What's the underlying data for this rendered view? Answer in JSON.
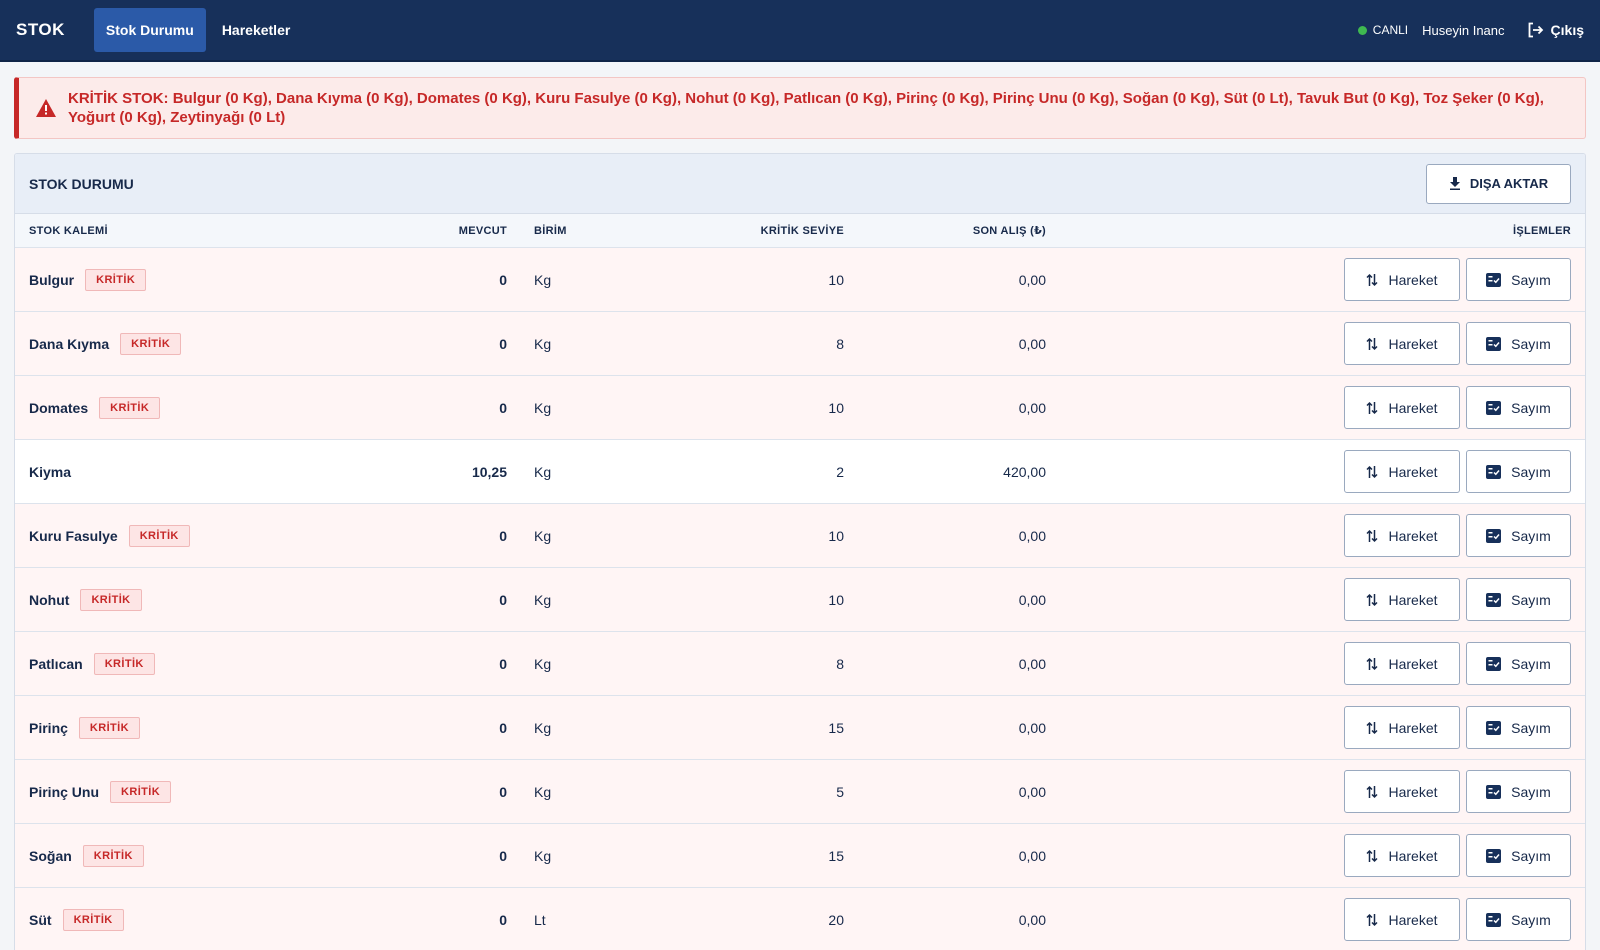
{
  "topbar": {
    "brand": "STOK",
    "tabs": [
      {
        "label": "Stok Durumu",
        "active": true
      },
      {
        "label": "Hareketler",
        "active": false
      }
    ],
    "status": "CANLI",
    "status_color": "#3fb950",
    "user": "Huseyin Inanc",
    "logout_label": "Çıkış"
  },
  "alert": {
    "text": "KRİTİK STOK: Bulgur (0 Kg), Dana Kıyma (0 Kg), Domates (0 Kg), Kuru Fasulye (0 Kg), Nohut (0 Kg), Patlıcan (0 Kg), Pirinç (0 Kg), Pirinç Unu (0 Kg), Soğan (0 Kg), Süt (0 Lt), Tavuk But (0 Kg), Toz Şeker (0 Kg), Yoğurt (0 Kg), Zeytinyağı (0 Lt)",
    "icon": "warning-icon",
    "color": "#c62828"
  },
  "panel": {
    "title": "STOK DURUMU",
    "export_label": "DIŞA AKTAR",
    "columns": {
      "name": "STOK KALEMİ",
      "qty": "MEVCUT",
      "unit": "BİRİM",
      "critical": "KRİTİK SEVİYE",
      "last_price": "SON ALIŞ (₺)",
      "actions": "İŞLEMLER"
    },
    "badge_label": "KRİTİK",
    "move_label": "Hareket",
    "count_label": "Sayım",
    "rows": [
      {
        "name": "Bulgur",
        "critical_flag": true,
        "qty": "0",
        "unit": "Kg",
        "critical_level": "10",
        "last_price": "0,00"
      },
      {
        "name": "Dana Kıyma",
        "critical_flag": true,
        "qty": "0",
        "unit": "Kg",
        "critical_level": "8",
        "last_price": "0,00"
      },
      {
        "name": "Domates",
        "critical_flag": true,
        "qty": "0",
        "unit": "Kg",
        "critical_level": "10",
        "last_price": "0,00"
      },
      {
        "name": "Kiyma",
        "critical_flag": false,
        "qty": "10,25",
        "unit": "Kg",
        "critical_level": "2",
        "last_price": "420,00"
      },
      {
        "name": "Kuru Fasulye",
        "critical_flag": true,
        "qty": "0",
        "unit": "Kg",
        "critical_level": "10",
        "last_price": "0,00"
      },
      {
        "name": "Nohut",
        "critical_flag": true,
        "qty": "0",
        "unit": "Kg",
        "critical_level": "10",
        "last_price": "0,00"
      },
      {
        "name": "Patlıcan",
        "critical_flag": true,
        "qty": "0",
        "unit": "Kg",
        "critical_level": "8",
        "last_price": "0,00"
      },
      {
        "name": "Pirinç",
        "critical_flag": true,
        "qty": "0",
        "unit": "Kg",
        "critical_level": "15",
        "last_price": "0,00"
      },
      {
        "name": "Pirinç Unu",
        "critical_flag": true,
        "qty": "0",
        "unit": "Kg",
        "critical_level": "5",
        "last_price": "0,00"
      },
      {
        "name": "Soğan",
        "critical_flag": true,
        "qty": "0",
        "unit": "Kg",
        "critical_level": "15",
        "last_price": "0,00"
      },
      {
        "name": "Süt",
        "critical_flag": true,
        "qty": "0",
        "unit": "Lt",
        "critical_level": "20",
        "last_price": "0,00"
      }
    ]
  }
}
